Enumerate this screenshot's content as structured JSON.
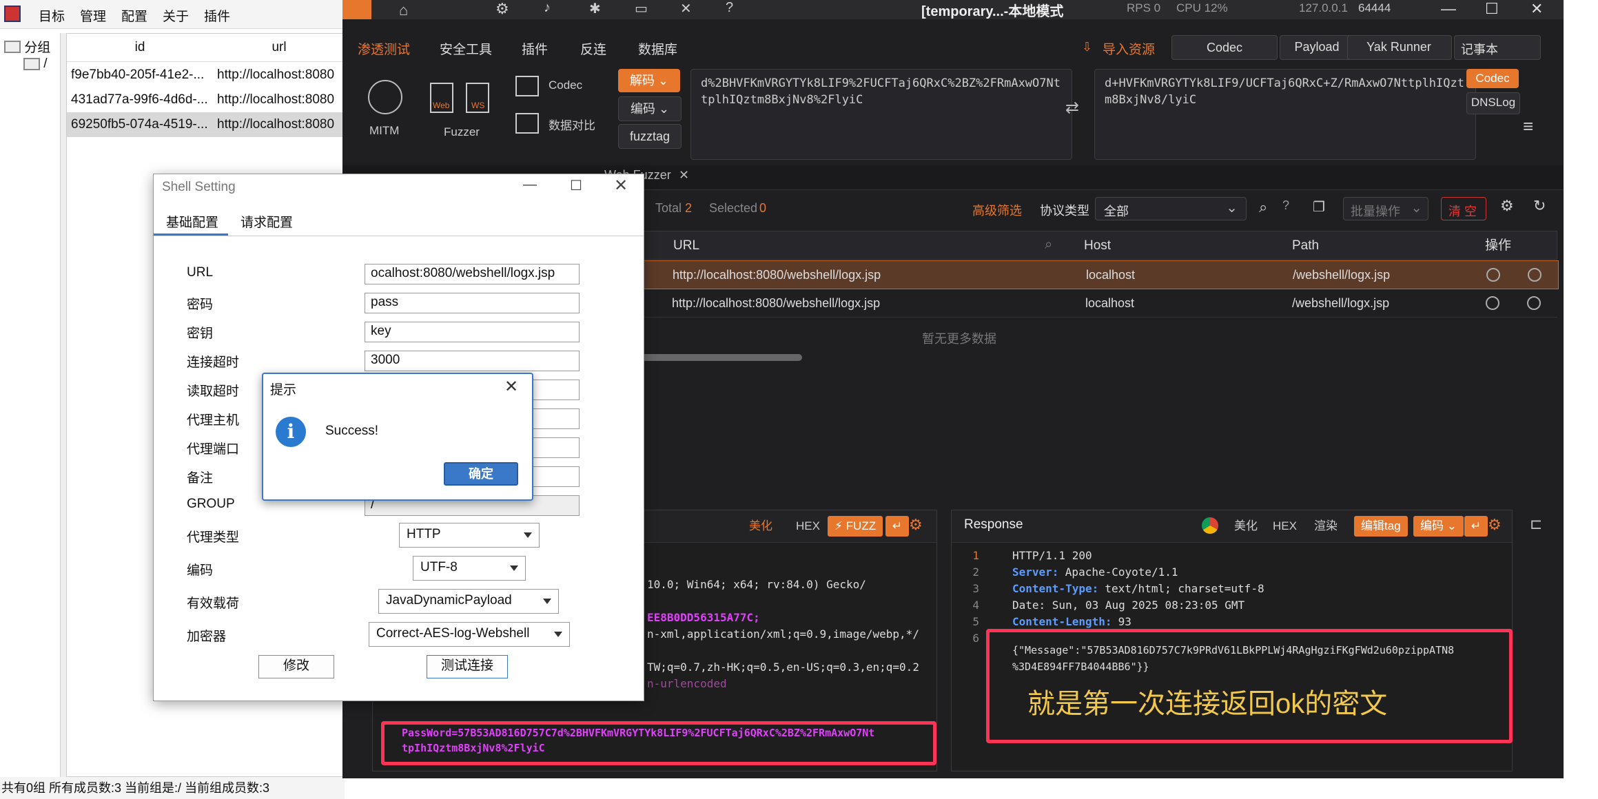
{
  "left_app": {
    "menu": [
      "目标",
      "管理",
      "配置",
      "关于",
      "插件"
    ],
    "tree": {
      "root": "分组",
      "child": "/"
    },
    "table": {
      "columns": [
        "id",
        "url"
      ],
      "rows": [
        {
          "id": "f9e7bb40-205f-41e2-...",
          "url": "http://localhost:8080"
        },
        {
          "id": "431ad77a-99f6-4d6d-...",
          "url": "http://localhost:8080"
        },
        {
          "id": "69250fb5-074a-4519-...",
          "url": "http://localhost:8080"
        }
      ]
    },
    "status": "共有0组 所有成员数:3 当前组是:/ 当前组成员数:3"
  },
  "yakit": {
    "topbar": {
      "title": "[temporary...-本地模式",
      "rps": "RPS 0",
      "cpu": "CPU 12%",
      "address": "127.0.0.1",
      "port": "64444"
    },
    "nav": [
      "渗透测试",
      "安全工具",
      "插件",
      "反连",
      "数据库"
    ],
    "nav_right": {
      "import": "导入资源",
      "codec": "Codec",
      "payload": "Payload",
      "yak_runner": "Yak Runner",
      "notepad": "记事本"
    },
    "tools": {
      "mitm": "MITM",
      "fuzzer": "Fuzzer",
      "codec": "Codec",
      "compare": "数据对比",
      "web_label": "Web",
      "ws_label": "WS"
    },
    "codec_bar": {
      "decode": "解码",
      "encode": "编码",
      "fuzztag": "fuzztag",
      "input": "d%2BHVFKmVRGYTYk8LIF9%2FUCFTaj6QRxC%2BZ%2FRmAxwO7NttplhIQztm8BxjNv8%2FlyiC",
      "output": "d+HVFKmVRGYTYk8LIF9/UCFTaj6QRxC+Z/RmAxwO7NttplhIQztm8BxjNv8/lyiC",
      "codec_btn": "Codec",
      "dnslog_btn": "DNSLog"
    },
    "tabs": {
      "fuzzer": "Web Fuzzer"
    },
    "filter": {
      "total_label": "Total",
      "total": "2",
      "selected_label": "Selected",
      "selected": "0",
      "advanced": "高级筛选",
      "protocol_label": "协议类型",
      "protocol_value": "全部",
      "batch": "批量操作",
      "clear": "清 空"
    },
    "grid": {
      "columns": [
        "URL",
        "Host",
        "Path",
        "操作"
      ],
      "rows": [
        {
          "url": "http://localhost:8080/webshell/logx.jsp",
          "host": "localhost",
          "path": "/webshell/logx.jsp"
        },
        {
          "url": "http://localhost:8080/webshell/logx.jsp",
          "host": "localhost",
          "path": "/webshell/logx.jsp"
        }
      ],
      "empty": "暂无更多数据"
    },
    "request": {
      "buttons": {
        "beautify": "美化",
        "hex": "HEX",
        "fuzz": "FUZZ"
      },
      "lines": [
        "10.0; Win64; x64; rv:84.0) Gecko/",
        "EE8B0DD56315A77C;",
        "n-xml,application/xml;q=0.9,image/webp,*/",
        "TW;q=0.7,zh-HK;q=0.5,en-US;q=0.3,en;q=0.2",
        "n-urlencoded"
      ],
      "body_line1": "PassWord=57B53AD816D757C7d%2BHVFKmVRGYTYk8LIF9%2FUCFTaj6QRxC%2BZ%2FRmAxwO7Nt",
      "body_line2": "tpIhIQztm8BxjNv8%2FlyiC"
    },
    "response": {
      "title": "Response",
      "buttons": {
        "beautify": "美化",
        "hex": "HEX",
        "render": "渲染",
        "edit_tag": "编辑tag",
        "encode": "编码"
      },
      "lines": [
        {
          "n": "1",
          "text": "HTTP/1.1 200"
        },
        {
          "n": "2",
          "key": "Server:",
          "val": "Apache-Coyote/1.1"
        },
        {
          "n": "3",
          "key": "Content-Type:",
          "val": "text/html; charset=utf-8"
        },
        {
          "n": "4",
          "text": "Date: Sun, 03 Aug 2025 08:23:05 GMT"
        },
        {
          "n": "5",
          "key": "Content-Length:",
          "val": "93"
        },
        {
          "n": "6",
          "text": ""
        }
      ],
      "json_line1": "{\"Message\":\"57B53AD816D757C7k9PRdV61LBkPPLWj4RAgHgziFKgFWd2u60pzippATN8",
      "json_line2": "%3D4E894FF7B4044BB6\"}}",
      "annotation": "就是第一次连接返回ok的密文"
    }
  },
  "shell_dialog": {
    "title": "Shell Setting",
    "tabs": [
      "基础配置",
      "请求配置"
    ],
    "fields": {
      "url_label": "URL",
      "url_value": "ocalhost:8080/webshell/logx.jsp",
      "password_label": "密码",
      "password_value": "pass",
      "key_label": "密钥",
      "key_value": "key",
      "conn_timeout_label": "连接超时",
      "conn_timeout_value": "3000",
      "read_timeout_label": "读取超时",
      "proxy_host_label": "代理主机",
      "proxy_port_label": "代理端口",
      "note_label": "备注",
      "group_label": "GROUP",
      "group_value": "/",
      "proxy_type_label": "代理类型",
      "proxy_type_value": "HTTP",
      "encoding_label": "编码",
      "encoding_value": "UTF-8",
      "payload_label": "有效载荷",
      "payload_value": "JavaDynamicPayload",
      "crypto_label": "加密器",
      "crypto_value": "Correct-AES-log-Webshell"
    },
    "buttons": {
      "modify": "修改",
      "test": "测试连接"
    }
  },
  "tip_dialog": {
    "title": "提示",
    "message": "Success!",
    "ok": "确定"
  }
}
